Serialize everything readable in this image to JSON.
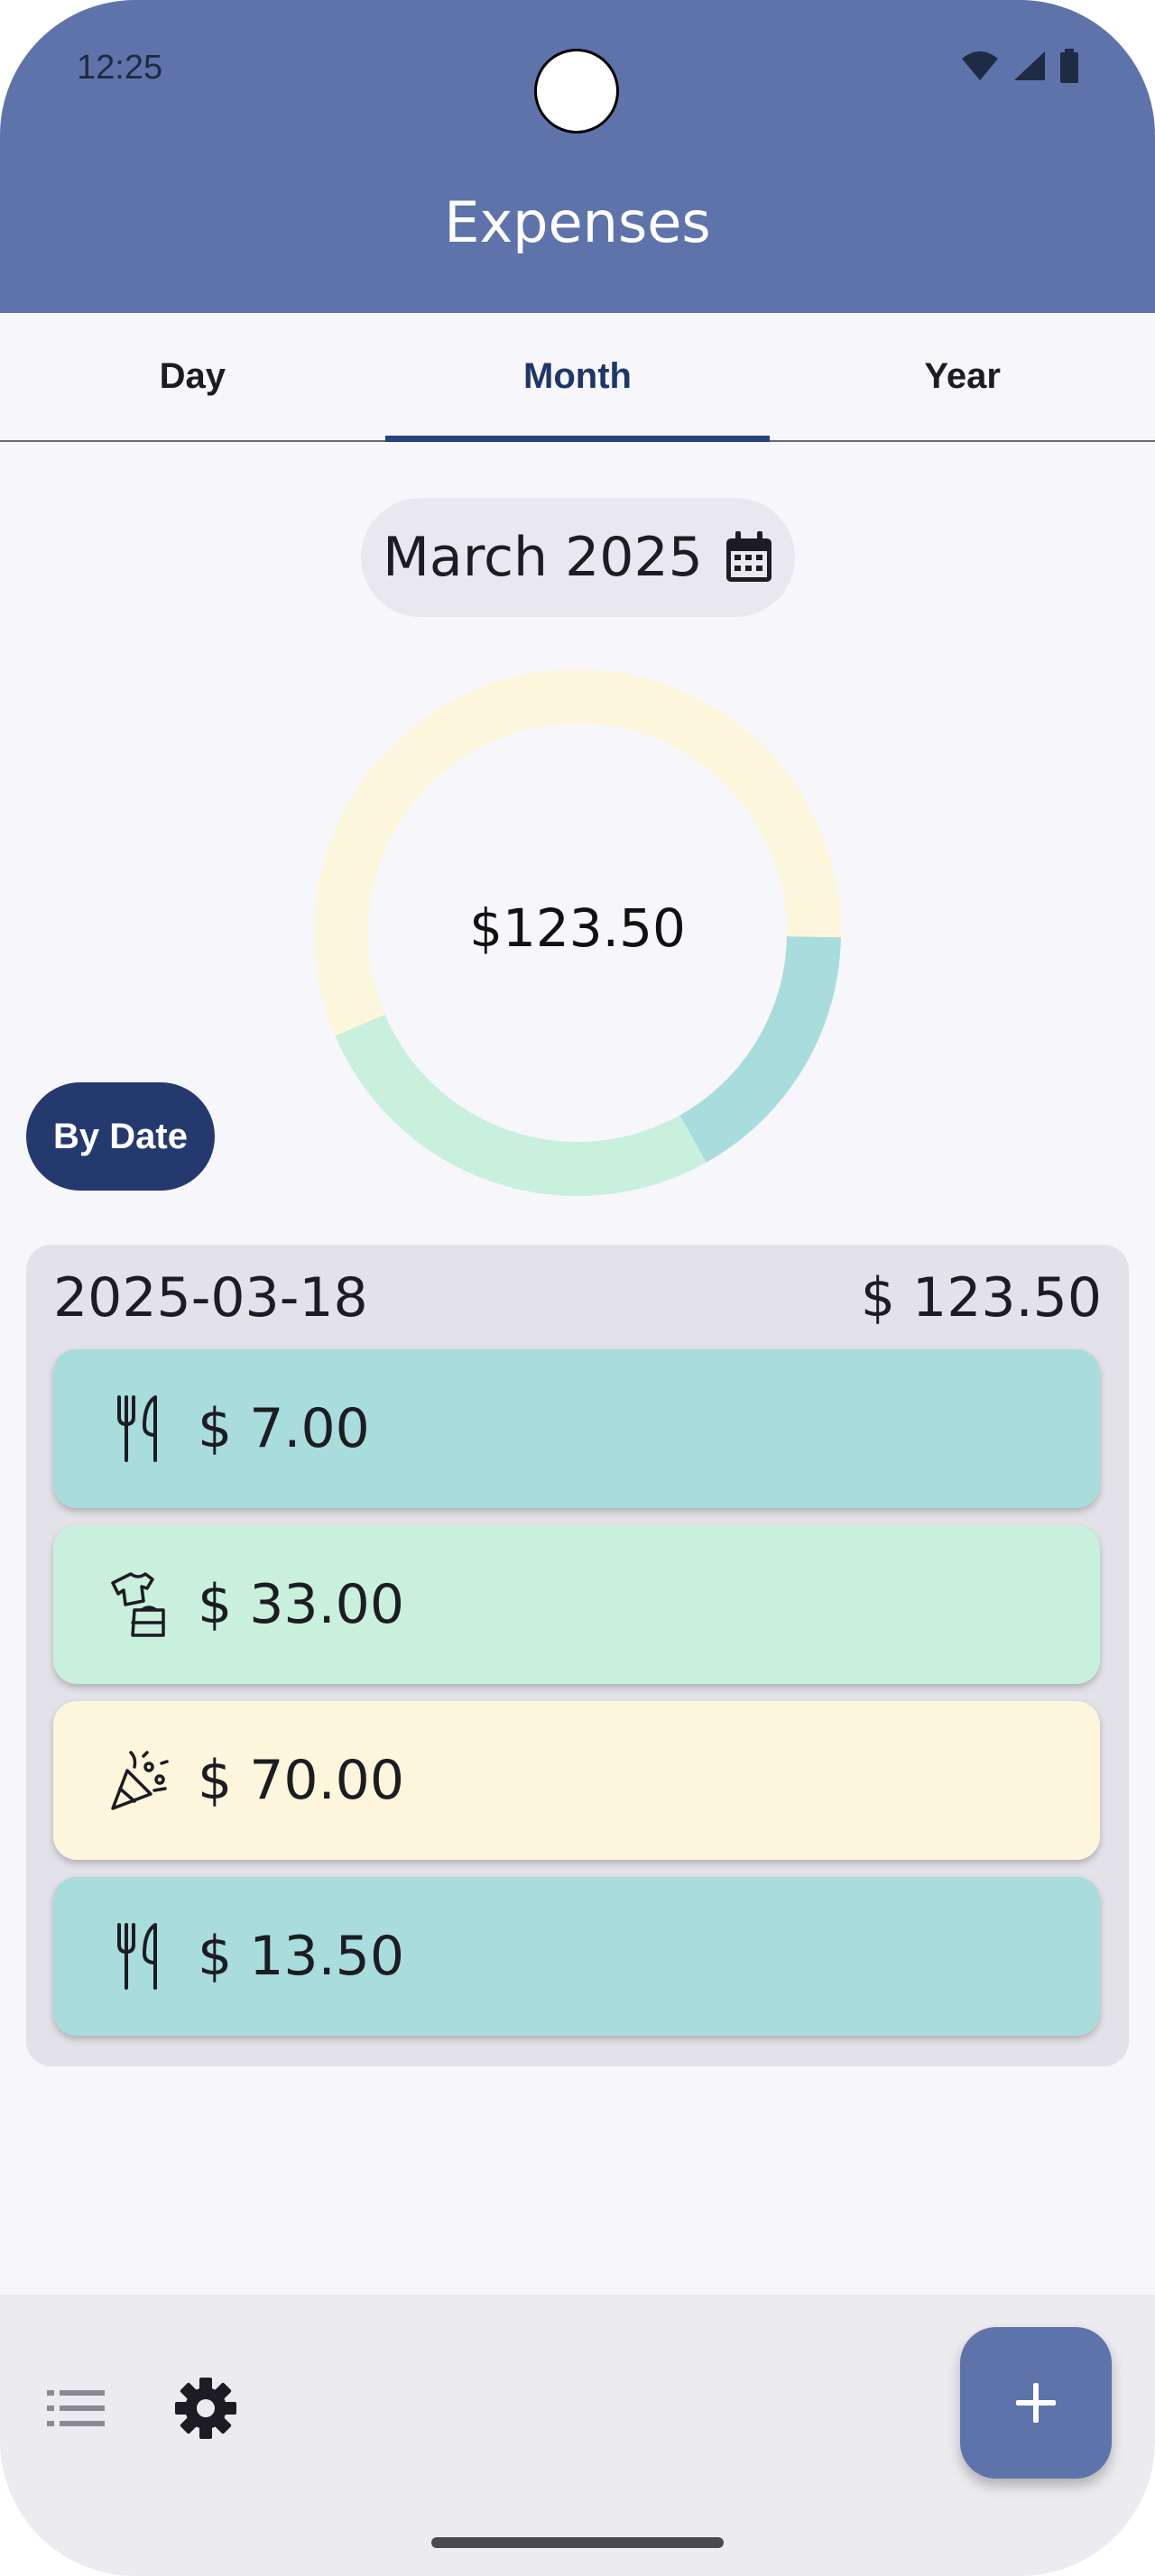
{
  "status_bar": {
    "time": "12:25"
  },
  "app": {
    "title": "Expenses"
  },
  "tabs": [
    {
      "label": "Day",
      "active": false
    },
    {
      "label": "Month",
      "active": true
    },
    {
      "label": "Year",
      "active": false
    }
  ],
  "period_selector": {
    "label": "March 2025",
    "icon": "calendar-icon"
  },
  "summary": {
    "total": "$123.50",
    "segments": [
      {
        "category": "restaurant",
        "amount": 20.5,
        "color": "#a9dcdc"
      },
      {
        "category": "clothing",
        "amount": 33.0,
        "color": "#c8f0dc"
      },
      {
        "category": "party",
        "amount": 70.0,
        "color": "#fdf6dc"
      }
    ]
  },
  "sort_button": {
    "label": "By Date"
  },
  "group": {
    "date": "2025-03-18",
    "total": "$ 123.50",
    "items": [
      {
        "amount": "$ 7.00",
        "icon": "fork-knife-icon",
        "color": "#a9dcdc"
      },
      {
        "amount": "$ 33.00",
        "icon": "clothing-icon",
        "color": "#c8f0dc"
      },
      {
        "amount": "$ 70.00",
        "icon": "party-popper-icon",
        "color": "#fdf6dc"
      },
      {
        "amount": "$ 13.50",
        "icon": "fork-knife-icon",
        "color": "#a9dcdc"
      }
    ]
  },
  "bottom_nav": {
    "icons": [
      "list-icon",
      "gear-icon"
    ],
    "fab_icon": "plus-icon"
  },
  "colors": {
    "primary": "#5f73ab",
    "accent": "#27427d",
    "background": "#f6f6fb"
  }
}
